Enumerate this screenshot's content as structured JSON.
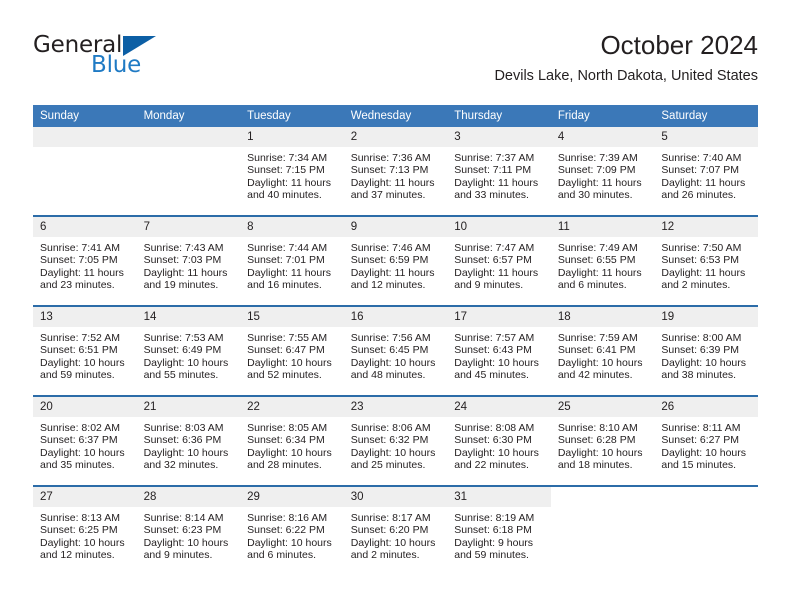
{
  "brand": {
    "name_part1": "General",
    "name_part2": "Blue",
    "triangle_color": "#0c5fa5",
    "blue_text_color": "#1f7ac4"
  },
  "header": {
    "title": "October 2024",
    "subtitle": "Devils Lake, North Dakota, United States",
    "header_bg_color": "#3b78b8",
    "row_divider_color": "#2c6ca8",
    "daynum_bg_color": "#efefef"
  },
  "weekday_headers": [
    "Sunday",
    "Monday",
    "Tuesday",
    "Wednesday",
    "Thursday",
    "Friday",
    "Saturday"
  ],
  "weeks": [
    [
      {
        "day": "",
        "empty": true
      },
      {
        "day": "",
        "empty": true
      },
      {
        "day": "1",
        "sunrise": "Sunrise: 7:34 AM",
        "sunset": "Sunset: 7:15 PM",
        "daylight": "Daylight: 11 hours and 40 minutes."
      },
      {
        "day": "2",
        "sunrise": "Sunrise: 7:36 AM",
        "sunset": "Sunset: 7:13 PM",
        "daylight": "Daylight: 11 hours and 37 minutes."
      },
      {
        "day": "3",
        "sunrise": "Sunrise: 7:37 AM",
        "sunset": "Sunset: 7:11 PM",
        "daylight": "Daylight: 11 hours and 33 minutes."
      },
      {
        "day": "4",
        "sunrise": "Sunrise: 7:39 AM",
        "sunset": "Sunset: 7:09 PM",
        "daylight": "Daylight: 11 hours and 30 minutes."
      },
      {
        "day": "5",
        "sunrise": "Sunrise: 7:40 AM",
        "sunset": "Sunset: 7:07 PM",
        "daylight": "Daylight: 11 hours and 26 minutes."
      }
    ],
    [
      {
        "day": "6",
        "sunrise": "Sunrise: 7:41 AM",
        "sunset": "Sunset: 7:05 PM",
        "daylight": "Daylight: 11 hours and 23 minutes."
      },
      {
        "day": "7",
        "sunrise": "Sunrise: 7:43 AM",
        "sunset": "Sunset: 7:03 PM",
        "daylight": "Daylight: 11 hours and 19 minutes."
      },
      {
        "day": "8",
        "sunrise": "Sunrise: 7:44 AM",
        "sunset": "Sunset: 7:01 PM",
        "daylight": "Daylight: 11 hours and 16 minutes."
      },
      {
        "day": "9",
        "sunrise": "Sunrise: 7:46 AM",
        "sunset": "Sunset: 6:59 PM",
        "daylight": "Daylight: 11 hours and 12 minutes."
      },
      {
        "day": "10",
        "sunrise": "Sunrise: 7:47 AM",
        "sunset": "Sunset: 6:57 PM",
        "daylight": "Daylight: 11 hours and 9 minutes."
      },
      {
        "day": "11",
        "sunrise": "Sunrise: 7:49 AM",
        "sunset": "Sunset: 6:55 PM",
        "daylight": "Daylight: 11 hours and 6 minutes."
      },
      {
        "day": "12",
        "sunrise": "Sunrise: 7:50 AM",
        "sunset": "Sunset: 6:53 PM",
        "daylight": "Daylight: 11 hours and 2 minutes."
      }
    ],
    [
      {
        "day": "13",
        "sunrise": "Sunrise: 7:52 AM",
        "sunset": "Sunset: 6:51 PM",
        "daylight": "Daylight: 10 hours and 59 minutes."
      },
      {
        "day": "14",
        "sunrise": "Sunrise: 7:53 AM",
        "sunset": "Sunset: 6:49 PM",
        "daylight": "Daylight: 10 hours and 55 minutes."
      },
      {
        "day": "15",
        "sunrise": "Sunrise: 7:55 AM",
        "sunset": "Sunset: 6:47 PM",
        "daylight": "Daylight: 10 hours and 52 minutes."
      },
      {
        "day": "16",
        "sunrise": "Sunrise: 7:56 AM",
        "sunset": "Sunset: 6:45 PM",
        "daylight": "Daylight: 10 hours and 48 minutes."
      },
      {
        "day": "17",
        "sunrise": "Sunrise: 7:57 AM",
        "sunset": "Sunset: 6:43 PM",
        "daylight": "Daylight: 10 hours and 45 minutes."
      },
      {
        "day": "18",
        "sunrise": "Sunrise: 7:59 AM",
        "sunset": "Sunset: 6:41 PM",
        "daylight": "Daylight: 10 hours and 42 minutes."
      },
      {
        "day": "19",
        "sunrise": "Sunrise: 8:00 AM",
        "sunset": "Sunset: 6:39 PM",
        "daylight": "Daylight: 10 hours and 38 minutes."
      }
    ],
    [
      {
        "day": "20",
        "sunrise": "Sunrise: 8:02 AM",
        "sunset": "Sunset: 6:37 PM",
        "daylight": "Daylight: 10 hours and 35 minutes."
      },
      {
        "day": "21",
        "sunrise": "Sunrise: 8:03 AM",
        "sunset": "Sunset: 6:36 PM",
        "daylight": "Daylight: 10 hours and 32 minutes."
      },
      {
        "day": "22",
        "sunrise": "Sunrise: 8:05 AM",
        "sunset": "Sunset: 6:34 PM",
        "daylight": "Daylight: 10 hours and 28 minutes."
      },
      {
        "day": "23",
        "sunrise": "Sunrise: 8:06 AM",
        "sunset": "Sunset: 6:32 PM",
        "daylight": "Daylight: 10 hours and 25 minutes."
      },
      {
        "day": "24",
        "sunrise": "Sunrise: 8:08 AM",
        "sunset": "Sunset: 6:30 PM",
        "daylight": "Daylight: 10 hours and 22 minutes."
      },
      {
        "day": "25",
        "sunrise": "Sunrise: 8:10 AM",
        "sunset": "Sunset: 6:28 PM",
        "daylight": "Daylight: 10 hours and 18 minutes."
      },
      {
        "day": "26",
        "sunrise": "Sunrise: 8:11 AM",
        "sunset": "Sunset: 6:27 PM",
        "daylight": "Daylight: 10 hours and 15 minutes."
      }
    ],
    [
      {
        "day": "27",
        "sunrise": "Sunrise: 8:13 AM",
        "sunset": "Sunset: 6:25 PM",
        "daylight": "Daylight: 10 hours and 12 minutes."
      },
      {
        "day": "28",
        "sunrise": "Sunrise: 8:14 AM",
        "sunset": "Sunset: 6:23 PM",
        "daylight": "Daylight: 10 hours and 9 minutes."
      },
      {
        "day": "29",
        "sunrise": "Sunrise: 8:16 AM",
        "sunset": "Sunset: 6:22 PM",
        "daylight": "Daylight: 10 hours and 6 minutes."
      },
      {
        "day": "30",
        "sunrise": "Sunrise: 8:17 AM",
        "sunset": "Sunset: 6:20 PM",
        "daylight": "Daylight: 10 hours and 2 minutes."
      },
      {
        "day": "31",
        "sunrise": "Sunrise: 8:19 AM",
        "sunset": "Sunset: 6:18 PM",
        "daylight": "Daylight: 9 hours and 59 minutes."
      },
      {
        "day": "",
        "empty": true,
        "blank": true
      },
      {
        "day": "",
        "empty": true,
        "blank": true
      }
    ]
  ]
}
